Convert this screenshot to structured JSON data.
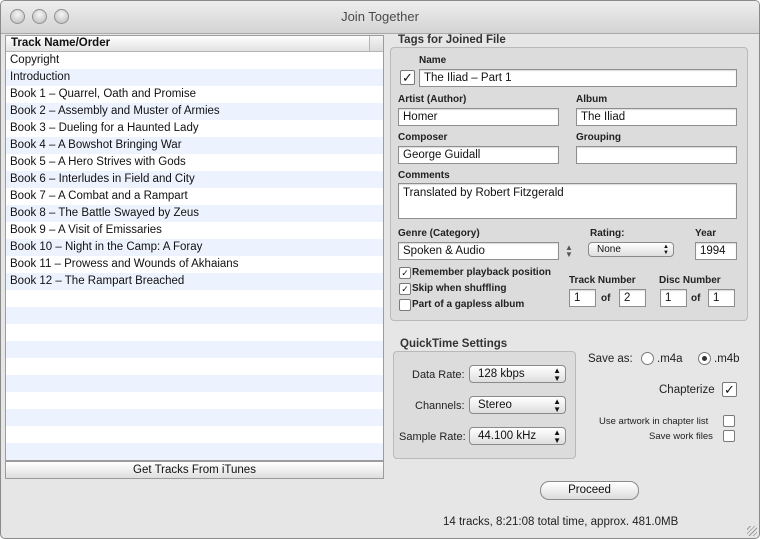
{
  "window": {
    "title": "Join Together"
  },
  "tracklist": {
    "header": "Track Name/Order",
    "tracks": [
      "Copyright",
      "Introduction",
      "Book 1 – Quarrel, Oath and Promise",
      "Book 2 – Assembly and Muster of Armies",
      "Book 3 – Dueling for a Haunted Lady",
      "Book 4 – A Bowshot Bringing War",
      "Book 5 – A Hero Strives with Gods",
      "Book 6 – Interludes in Field and City",
      "Book 7 – A Combat and a Rampart",
      "Book 8 – The Battle Swayed by Zeus",
      "Book 9 – A Visit of Emissaries",
      "Book 10 – Night in the Camp: A Foray",
      "Book 11 – Prowess and Wounds of Akhaians",
      "Book 12 – The Rampart Breached",
      "",
      "",
      "",
      "",
      "",
      "",
      "",
      "",
      "",
      ""
    ],
    "get_tracks_label": "Get Tracks From iTunes"
  },
  "tags": {
    "section_title": "Tags for Joined File",
    "name_label": "Name",
    "name_checked": true,
    "name_value": "The Iliad – Part 1",
    "artist_label": "Artist (Author)",
    "artist_value": "Homer",
    "album_label": "Album",
    "album_value": "The Iliad",
    "composer_label": "Composer",
    "composer_value": "George Guidall",
    "grouping_label": "Grouping",
    "grouping_value": "",
    "comments_label": "Comments",
    "comments_value": "Translated by Robert Fitzgerald",
    "genre_label": "Genre (Category)",
    "genre_value": "Spoken & Audio",
    "rating_label": "Rating:",
    "rating_value": "None",
    "year_label": "Year",
    "year_value": "1994",
    "remember_label": "Remember playback position",
    "remember_checked": true,
    "skip_label": "Skip when shuffling",
    "skip_checked": true,
    "gapless_label": "Part of a gapless album",
    "gapless_checked": false,
    "track_number_label": "Track Number",
    "track_number": "1",
    "track_total": "2",
    "of_label": "of",
    "disc_number_label": "Disc Number",
    "disc_number": "1",
    "disc_total": "1"
  },
  "quicktime": {
    "section_title": "QuickTime Settings",
    "data_rate_label": "Data Rate:",
    "data_rate_value": "128 kbps",
    "channels_label": "Channels:",
    "channels_value": "Stereo",
    "sample_rate_label": "Sample Rate:",
    "sample_rate_value": "44.100 kHz"
  },
  "output": {
    "save_as_label": "Save as:",
    "m4a_label": ".m4a",
    "m4b_label": ".m4b",
    "selected": ".m4b",
    "chapterize_label": "Chapterize",
    "chapterize_checked": true,
    "use_artwork_label": "Use artwork in chapter list",
    "use_artwork_checked": false,
    "save_work_label": "Save work files",
    "save_work_checked": false
  },
  "proceed_label": "Proceed",
  "status_text": "14 tracks, 8:21:08 total time, approx. 481.0MB"
}
